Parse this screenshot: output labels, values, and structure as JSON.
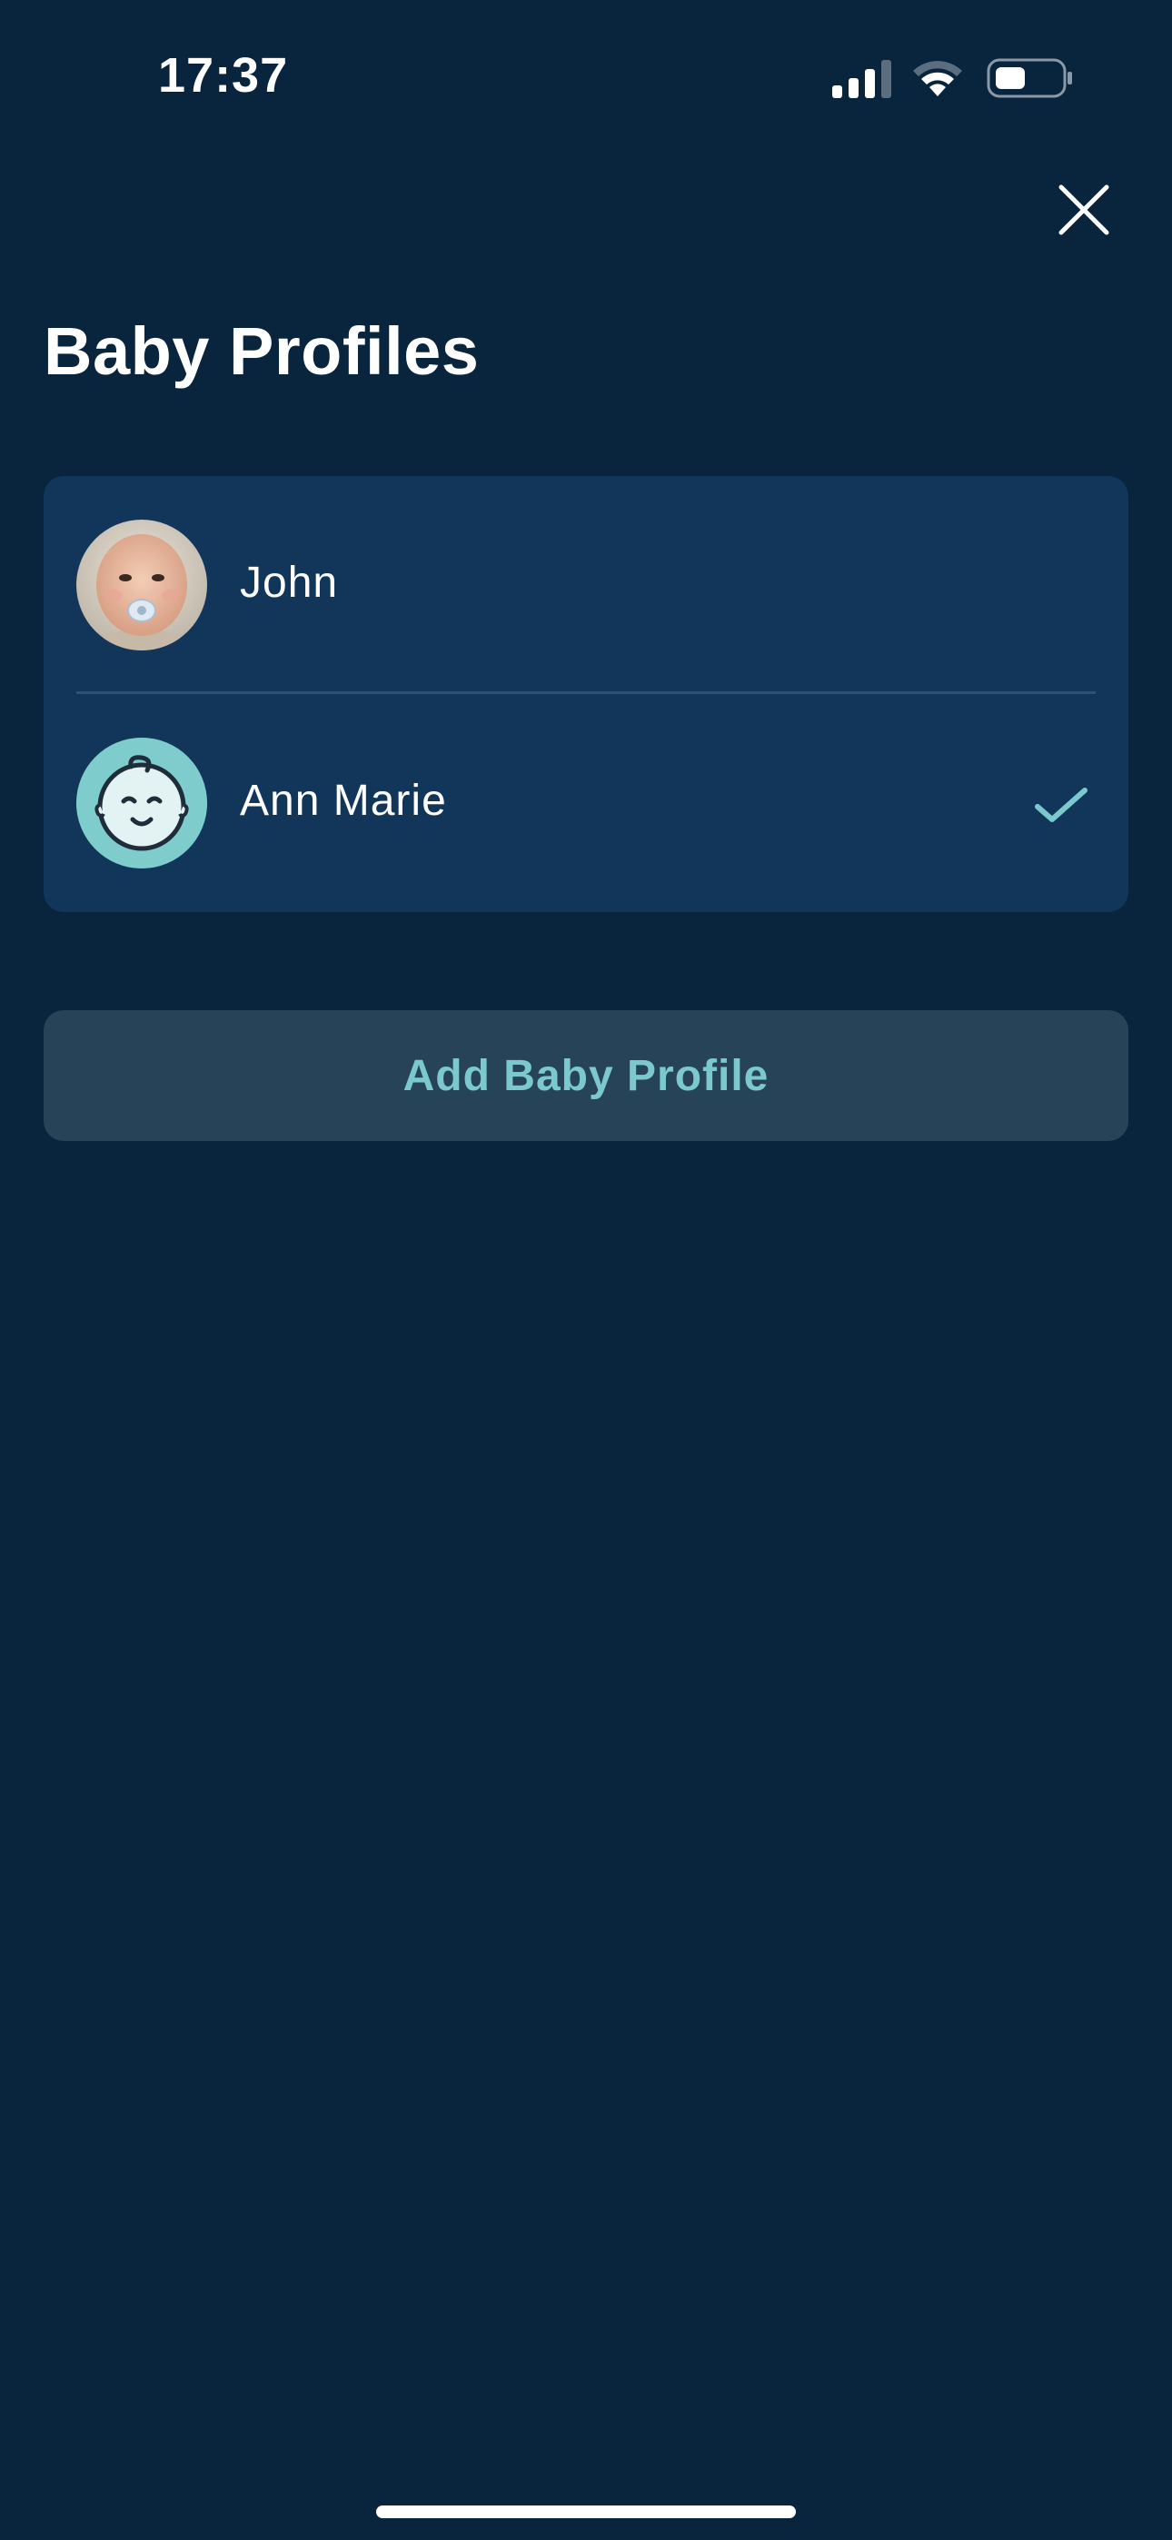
{
  "status_bar": {
    "time": "17:37",
    "icons": [
      "signal-icon",
      "wifi-icon",
      "battery-icon"
    ]
  },
  "header": {
    "close_icon": "close-icon",
    "title": "Baby Profiles"
  },
  "profiles": [
    {
      "name": "John",
      "avatar": "baby-photo-avatar",
      "selected": false
    },
    {
      "name": "Ann Marie",
      "avatar": "baby-face-icon",
      "selected": true
    }
  ],
  "add_button": {
    "label": "Add Baby Profile"
  },
  "colors": {
    "background": "#09243d",
    "card": "#11365a",
    "accent": "#7bc9cf",
    "button_bg": "#274357",
    "avatar_teal": "#7fcccc"
  }
}
